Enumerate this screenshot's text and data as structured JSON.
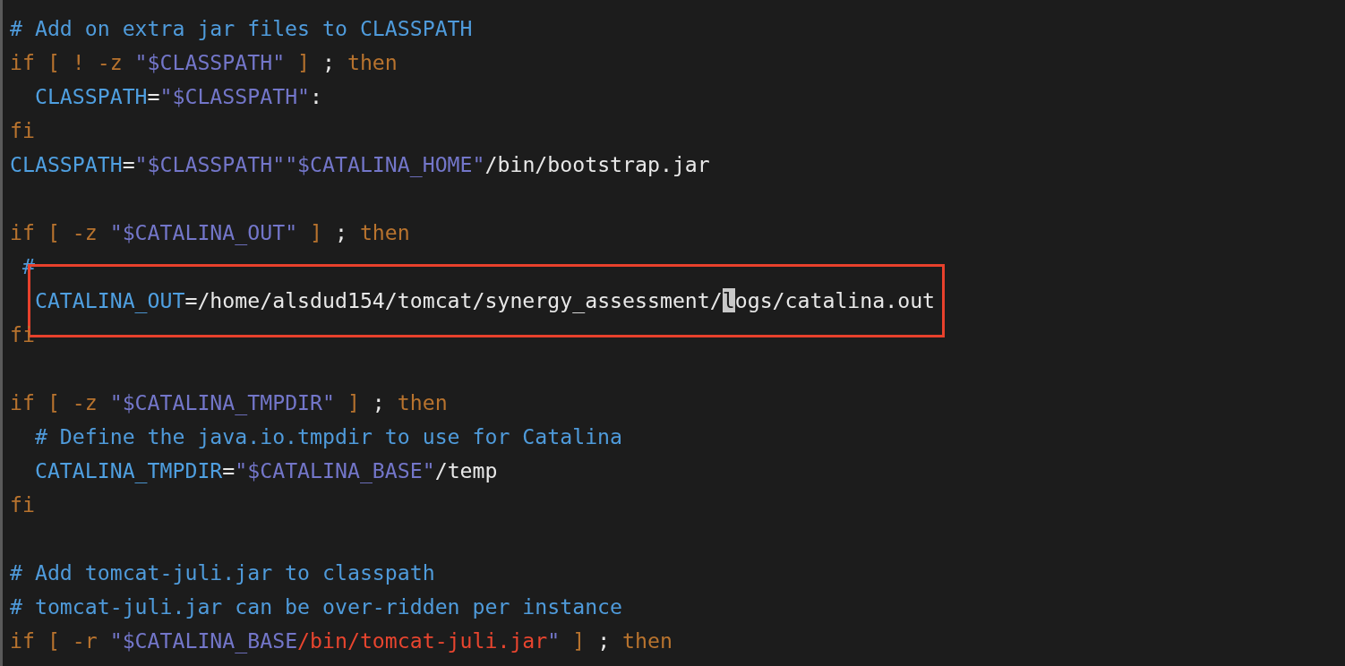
{
  "editor": {
    "lines": [
      {
        "kind": "code",
        "tokens": [
          {
            "kind": "comment",
            "text": "# Add on extra jar files to CLASSPATH"
          }
        ]
      },
      {
        "kind": "code",
        "tokens": [
          {
            "kind": "keyword",
            "text": "if [ ! -z "
          },
          {
            "kind": "string",
            "text": "\"$CLASSPATH\""
          },
          {
            "kind": "keyword",
            "text": " ]"
          },
          {
            "kind": "plain",
            "text": " ; "
          },
          {
            "kind": "keyword",
            "text": "then"
          }
        ]
      },
      {
        "kind": "code",
        "tokens": [
          {
            "kind": "variable",
            "text": "  CLASSPATH"
          },
          {
            "kind": "plain",
            "text": "="
          },
          {
            "kind": "string",
            "text": "\"$CLASSPATH\""
          },
          {
            "kind": "plain",
            "text": ":"
          }
        ]
      },
      {
        "kind": "code",
        "tokens": [
          {
            "kind": "keyword",
            "text": "fi"
          }
        ]
      },
      {
        "kind": "code",
        "tokens": [
          {
            "kind": "variable",
            "text": "CLASSPATH"
          },
          {
            "kind": "plain",
            "text": "="
          },
          {
            "kind": "string",
            "text": "\"$CLASSPATH\"\"$CATALINA_HOME\""
          },
          {
            "kind": "plain",
            "text": "/bin/bootstrap.jar"
          }
        ]
      },
      {
        "kind": "blank"
      },
      {
        "kind": "code",
        "tokens": [
          {
            "kind": "keyword",
            "text": "if [ -z "
          },
          {
            "kind": "string",
            "text": "\"$CATALINA_OUT\""
          },
          {
            "kind": "keyword",
            "text": " ]"
          },
          {
            "kind": "plain",
            "text": " ; "
          },
          {
            "kind": "keyword",
            "text": "then"
          }
        ]
      },
      {
        "kind": "code",
        "tokens": [
          {
            "kind": "comment",
            "text": " #"
          }
        ]
      },
      {
        "kind": "code",
        "boxed": true,
        "tokens": [
          {
            "kind": "variable",
            "text": "  CATALINA_OUT"
          },
          {
            "kind": "plain",
            "text": "=/home/alsdud154/tomcat/synergy_assessment/"
          },
          {
            "kind": "cursor",
            "text": "l"
          },
          {
            "kind": "plain",
            "text": "ogs/catalina.out"
          }
        ]
      },
      {
        "kind": "code",
        "tokens": [
          {
            "kind": "keyword",
            "text": "fi"
          }
        ]
      },
      {
        "kind": "blank"
      },
      {
        "kind": "code",
        "tokens": [
          {
            "kind": "keyword",
            "text": "if [ -z "
          },
          {
            "kind": "string",
            "text": "\"$CATALINA_TMPDIR\""
          },
          {
            "kind": "keyword",
            "text": " ]"
          },
          {
            "kind": "plain",
            "text": " ; "
          },
          {
            "kind": "keyword",
            "text": "then"
          }
        ]
      },
      {
        "kind": "code",
        "tokens": [
          {
            "kind": "comment",
            "text": "  # Define the java.io.tmpdir to use for Catalina"
          }
        ]
      },
      {
        "kind": "code",
        "tokens": [
          {
            "kind": "variable",
            "text": "  CATALINA_TMPDIR"
          },
          {
            "kind": "plain",
            "text": "="
          },
          {
            "kind": "string",
            "text": "\"$CATALINA_BASE\""
          },
          {
            "kind": "plain",
            "text": "/temp"
          }
        ]
      },
      {
        "kind": "code",
        "tokens": [
          {
            "kind": "keyword",
            "text": "fi"
          }
        ]
      },
      {
        "kind": "blank"
      },
      {
        "kind": "code",
        "tokens": [
          {
            "kind": "comment",
            "text": "# Add tomcat-juli.jar to classpath"
          }
        ]
      },
      {
        "kind": "code",
        "tokens": [
          {
            "kind": "comment",
            "text": "# tomcat-juli.jar can be over-ridden per instance"
          }
        ]
      },
      {
        "kind": "code",
        "tokens": [
          {
            "kind": "keyword",
            "text": "if [ -r "
          },
          {
            "kind": "string",
            "text": "\"$CATALINA_BASE"
          },
          {
            "kind": "error",
            "text": "/bin/tomcat-juli.jar"
          },
          {
            "kind": "string",
            "text": "\""
          },
          {
            "kind": "keyword",
            "text": " ]"
          },
          {
            "kind": "plain",
            "text": " ; "
          },
          {
            "kind": "keyword",
            "text": "then"
          }
        ]
      }
    ]
  }
}
